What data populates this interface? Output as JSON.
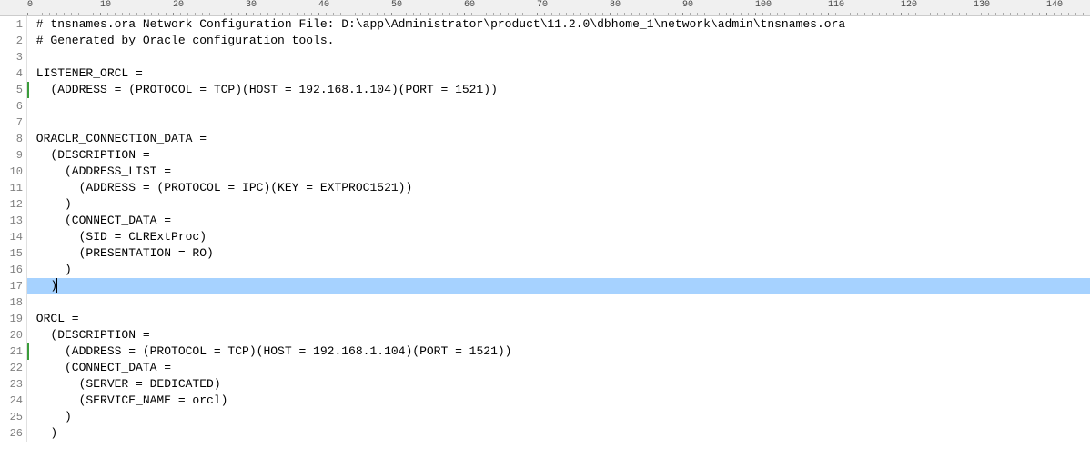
{
  "ruler": {
    "majorTicks": [
      "0",
      "10",
      "20",
      "30",
      "40",
      "50",
      "60",
      "70",
      "80",
      "90",
      "100",
      "110",
      "120",
      "130",
      "140"
    ],
    "charWidth": 8.0,
    "offset": 30
  },
  "lines": [
    {
      "num": "1",
      "text": " # tnsnames.ora Network Configuration File: D:\\app\\Administrator\\product\\11.2.0\\dbhome_1\\network\\admin\\tnsnames.ora",
      "highlighted": false,
      "changeMark": false
    },
    {
      "num": "2",
      "text": " # Generated by Oracle configuration tools.",
      "highlighted": false,
      "changeMark": false
    },
    {
      "num": "3",
      "text": "",
      "highlighted": false,
      "changeMark": false
    },
    {
      "num": "4",
      "text": " LISTENER_ORCL =",
      "highlighted": false,
      "changeMark": false
    },
    {
      "num": "5",
      "text": "   (ADDRESS = (PROTOCOL = TCP)(HOST = 192.168.1.104)(PORT = 1521))",
      "highlighted": false,
      "changeMark": true
    },
    {
      "num": "6",
      "text": "",
      "highlighted": false,
      "changeMark": false
    },
    {
      "num": "7",
      "text": "",
      "highlighted": false,
      "changeMark": false
    },
    {
      "num": "8",
      "text": " ORACLR_CONNECTION_DATA =",
      "highlighted": false,
      "changeMark": false
    },
    {
      "num": "9",
      "text": "   (DESCRIPTION =",
      "highlighted": false,
      "changeMark": false
    },
    {
      "num": "10",
      "text": "     (ADDRESS_LIST =",
      "highlighted": false,
      "changeMark": false
    },
    {
      "num": "11",
      "text": "       (ADDRESS = (PROTOCOL = IPC)(KEY = EXTPROC1521))",
      "highlighted": false,
      "changeMark": false
    },
    {
      "num": "12",
      "text": "     )",
      "highlighted": false,
      "changeMark": false
    },
    {
      "num": "13",
      "text": "     (CONNECT_DATA =",
      "highlighted": false,
      "changeMark": false
    },
    {
      "num": "14",
      "text": "       (SID = CLRExtProc)",
      "highlighted": false,
      "changeMark": false
    },
    {
      "num": "15",
      "text": "       (PRESENTATION = RO)",
      "highlighted": false,
      "changeMark": false
    },
    {
      "num": "16",
      "text": "     )",
      "highlighted": false,
      "changeMark": false
    },
    {
      "num": "17",
      "text": "   )",
      "highlighted": true,
      "caret": true,
      "changeMark": false
    },
    {
      "num": "18",
      "text": "",
      "highlighted": false,
      "changeMark": false
    },
    {
      "num": "19",
      "text": " ORCL =",
      "highlighted": false,
      "changeMark": false
    },
    {
      "num": "20",
      "text": "   (DESCRIPTION =",
      "highlighted": false,
      "changeMark": false
    },
    {
      "num": "21",
      "text": "     (ADDRESS = (PROTOCOL = TCP)(HOST = 192.168.1.104)(PORT = 1521))",
      "highlighted": false,
      "changeMark": true
    },
    {
      "num": "22",
      "text": "     (CONNECT_DATA =",
      "highlighted": false,
      "changeMark": false
    },
    {
      "num": "23",
      "text": "       (SERVER = DEDICATED)",
      "highlighted": false,
      "changeMark": false
    },
    {
      "num": "24",
      "text": "       (SERVICE_NAME = orcl)",
      "highlighted": false,
      "changeMark": false
    },
    {
      "num": "25",
      "text": "     )",
      "highlighted": false,
      "changeMark": false
    },
    {
      "num": "26",
      "text": "   )",
      "highlighted": false,
      "changeMark": false
    }
  ]
}
